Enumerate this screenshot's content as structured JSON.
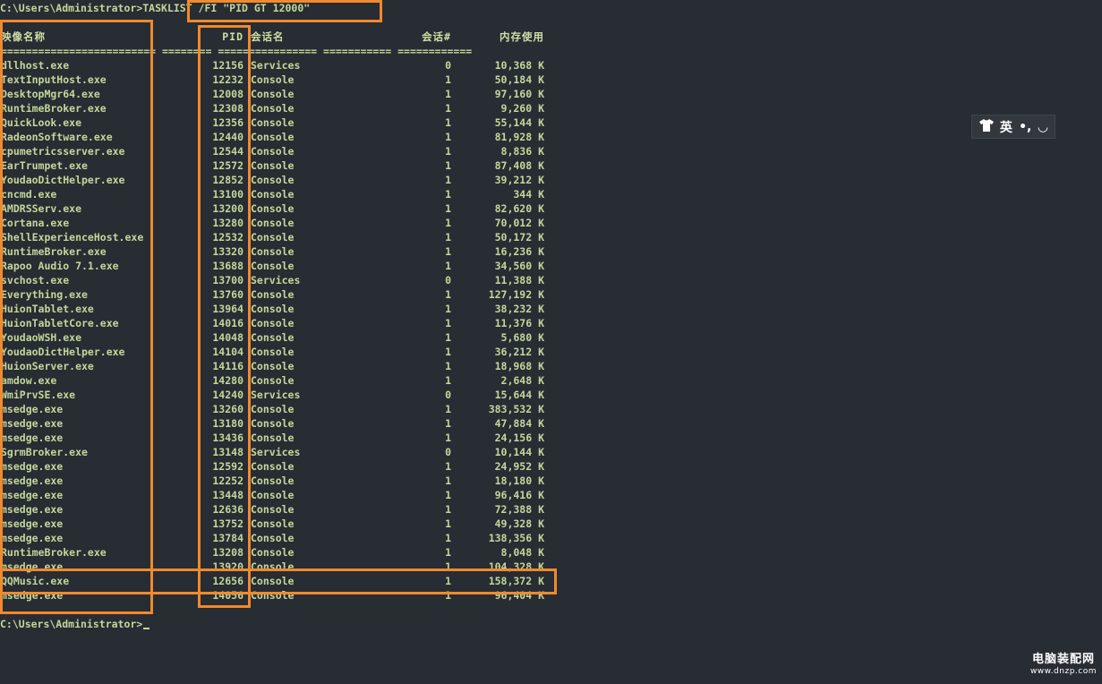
{
  "prompt": "C:\\Users\\Administrator>",
  "command": "TASKLIST /FI \"PID GT 12000\"",
  "headers": {
    "name": "映像名称",
    "pid": "PID",
    "session_name": "会话名",
    "session_num": "会话#",
    "mem": "内存使用"
  },
  "separator": "========================= ======== ================ =========== ============",
  "rows": [
    {
      "name": "dllhost.exe",
      "pid": "12156",
      "session": "Services",
      "num": "0",
      "mem": "10,368 K"
    },
    {
      "name": "TextInputHost.exe",
      "pid": "12232",
      "session": "Console",
      "num": "1",
      "mem": "50,184 K"
    },
    {
      "name": "DesktopMgr64.exe",
      "pid": "12008",
      "session": "Console",
      "num": "1",
      "mem": "97,160 K"
    },
    {
      "name": "RuntimeBroker.exe",
      "pid": "12308",
      "session": "Console",
      "num": "1",
      "mem": "9,260 K"
    },
    {
      "name": "QuickLook.exe",
      "pid": "12356",
      "session": "Console",
      "num": "1",
      "mem": "55,144 K"
    },
    {
      "name": "RadeonSoftware.exe",
      "pid": "12440",
      "session": "Console",
      "num": "1",
      "mem": "81,928 K"
    },
    {
      "name": "cpumetricsserver.exe",
      "pid": "12544",
      "session": "Console",
      "num": "1",
      "mem": "8,836 K"
    },
    {
      "name": "EarTrumpet.exe",
      "pid": "12572",
      "session": "Console",
      "num": "1",
      "mem": "87,408 K"
    },
    {
      "name": "YoudaoDictHelper.exe",
      "pid": "12852",
      "session": "Console",
      "num": "1",
      "mem": "39,212 K"
    },
    {
      "name": "cncmd.exe",
      "pid": "13100",
      "session": "Console",
      "num": "1",
      "mem": "344 K"
    },
    {
      "name": "AMDRSServ.exe",
      "pid": "13200",
      "session": "Console",
      "num": "1",
      "mem": "82,620 K"
    },
    {
      "name": "Cortana.exe",
      "pid": "13280",
      "session": "Console",
      "num": "1",
      "mem": "70,012 K"
    },
    {
      "name": "ShellExperienceHost.exe",
      "pid": "12532",
      "session": "Console",
      "num": "1",
      "mem": "50,172 K"
    },
    {
      "name": "RuntimeBroker.exe",
      "pid": "13320",
      "session": "Console",
      "num": "1",
      "mem": "16,236 K"
    },
    {
      "name": "Rapoo Audio 7.1.exe",
      "pid": "13688",
      "session": "Console",
      "num": "1",
      "mem": "34,560 K"
    },
    {
      "name": "svchost.exe",
      "pid": "13700",
      "session": "Services",
      "num": "0",
      "mem": "11,388 K"
    },
    {
      "name": "Everything.exe",
      "pid": "13760",
      "session": "Console",
      "num": "1",
      "mem": "127,192 K"
    },
    {
      "name": "HuionTablet.exe",
      "pid": "13964",
      "session": "Console",
      "num": "1",
      "mem": "38,232 K"
    },
    {
      "name": "HuionTabletCore.exe",
      "pid": "14016",
      "session": "Console",
      "num": "1",
      "mem": "11,376 K"
    },
    {
      "name": "YoudaoWSH.exe",
      "pid": "14048",
      "session": "Console",
      "num": "1",
      "mem": "5,680 K"
    },
    {
      "name": "YoudaoDictHelper.exe",
      "pid": "14104",
      "session": "Console",
      "num": "1",
      "mem": "36,212 K"
    },
    {
      "name": "HuionServer.exe",
      "pid": "14116",
      "session": "Console",
      "num": "1",
      "mem": "18,968 K"
    },
    {
      "name": "amdow.exe",
      "pid": "14280",
      "session": "Console",
      "num": "1",
      "mem": "2,648 K"
    },
    {
      "name": "WmiPrvSE.exe",
      "pid": "14240",
      "session": "Services",
      "num": "0",
      "mem": "15,644 K"
    },
    {
      "name": "msedge.exe",
      "pid": "13260",
      "session": "Console",
      "num": "1",
      "mem": "383,532 K"
    },
    {
      "name": "msedge.exe",
      "pid": "13180",
      "session": "Console",
      "num": "1",
      "mem": "47,884 K"
    },
    {
      "name": "msedge.exe",
      "pid": "13436",
      "session": "Console",
      "num": "1",
      "mem": "24,156 K"
    },
    {
      "name": "SgrmBroker.exe",
      "pid": "13148",
      "session": "Services",
      "num": "0",
      "mem": "10,144 K"
    },
    {
      "name": "msedge.exe",
      "pid": "12592",
      "session": "Console",
      "num": "1",
      "mem": "24,952 K"
    },
    {
      "name": "msedge.exe",
      "pid": "12252",
      "session": "Console",
      "num": "1",
      "mem": "18,180 K"
    },
    {
      "name": "msedge.exe",
      "pid": "13448",
      "session": "Console",
      "num": "1",
      "mem": "96,416 K"
    },
    {
      "name": "msedge.exe",
      "pid": "12636",
      "session": "Console",
      "num": "1",
      "mem": "72,388 K"
    },
    {
      "name": "msedge.exe",
      "pid": "13752",
      "session": "Console",
      "num": "1",
      "mem": "49,328 K"
    },
    {
      "name": "msedge.exe",
      "pid": "13784",
      "session": "Console",
      "num": "1",
      "mem": "138,356 K"
    },
    {
      "name": "RuntimeBroker.exe",
      "pid": "13208",
      "session": "Console",
      "num": "1",
      "mem": "8,048 K"
    },
    {
      "name": "msedge.exe",
      "pid": "13920",
      "session": "Console",
      "num": "1",
      "mem": "104,328 K"
    },
    {
      "name": "QQMusic.exe",
      "pid": "12656",
      "session": "Console",
      "num": "1",
      "mem": "158,372 K"
    },
    {
      "name": "msedge.exe",
      "pid": "14056",
      "session": "Console",
      "num": "1",
      "mem": "96,404 K"
    }
  ],
  "ime": {
    "icon": "shirt-icon",
    "label": "英",
    "punct": "•,",
    "moon": "◡"
  },
  "watermark": {
    "title": "电脑装配网",
    "url": "www.dnzp.com"
  },
  "colors": {
    "background": "#282c33",
    "text": "#c3d79a",
    "highlight": "#f08a2c"
  }
}
